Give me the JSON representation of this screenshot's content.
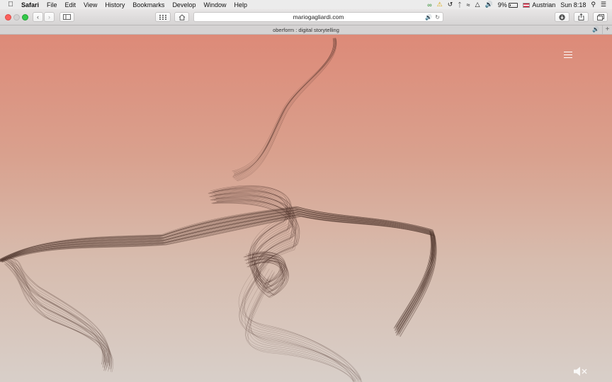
{
  "menubar": {
    "app": "Safari",
    "items": [
      "File",
      "Edit",
      "View",
      "History",
      "Bookmarks",
      "Develop",
      "Window",
      "Help"
    ],
    "battery": "9%",
    "input_source": "Austrian",
    "clock": "Sun 8:18"
  },
  "toolbar": {
    "url": "mariogagliardi.com"
  },
  "tab": {
    "title": "oberform : digital storytelling"
  },
  "colors": {
    "page_top": "#dd8a78",
    "page_bottom": "#d8cfc9",
    "strand": "#4a3028"
  }
}
